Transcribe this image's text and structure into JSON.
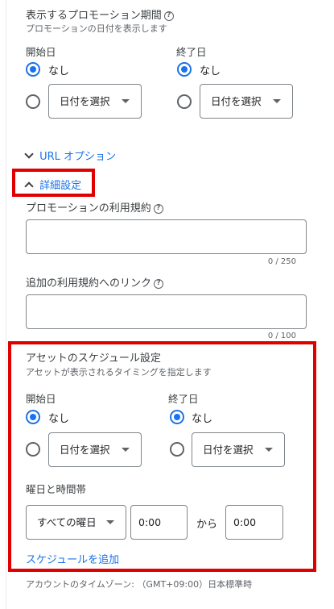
{
  "promo_period": {
    "title": "表示するプロモーション期間",
    "subtitle": "プロモーションの日付を表示します",
    "start_label": "開始日",
    "end_label": "終了日",
    "none_label": "なし",
    "select_date": "日付を選択"
  },
  "url_options": {
    "label": "URL オプション"
  },
  "advanced": {
    "label": "詳細設定"
  },
  "promo_terms": {
    "label": "プロモーションの利用規約",
    "counter": "0 / 250"
  },
  "terms_link": {
    "label": "追加の利用規約へのリンク",
    "counter": "0 / 100"
  },
  "schedule": {
    "title": "アセットのスケジュール設定",
    "subtitle": "アセットが表示されるタイミングを指定します",
    "start_label": "開始日",
    "end_label": "終了日",
    "none_label": "なし",
    "select_date": "日付を選択",
    "day_time_label": "曜日と時間帯",
    "all_days": "すべての曜日",
    "from_time": "0:00",
    "separator": "から",
    "to_time": "0:00",
    "add_schedule": "スケジュールを追加"
  },
  "timezone": {
    "text": "アカウントのタイムゾーン: （GMT+09:00）日本標準時"
  },
  "colors": {
    "accent": "#1a73e8",
    "highlight": "#e00000",
    "border": "#80868b"
  },
  "icons": [
    "help-icon",
    "chevron-down-icon",
    "chevron-up-icon",
    "dropdown-caret-icon"
  ]
}
